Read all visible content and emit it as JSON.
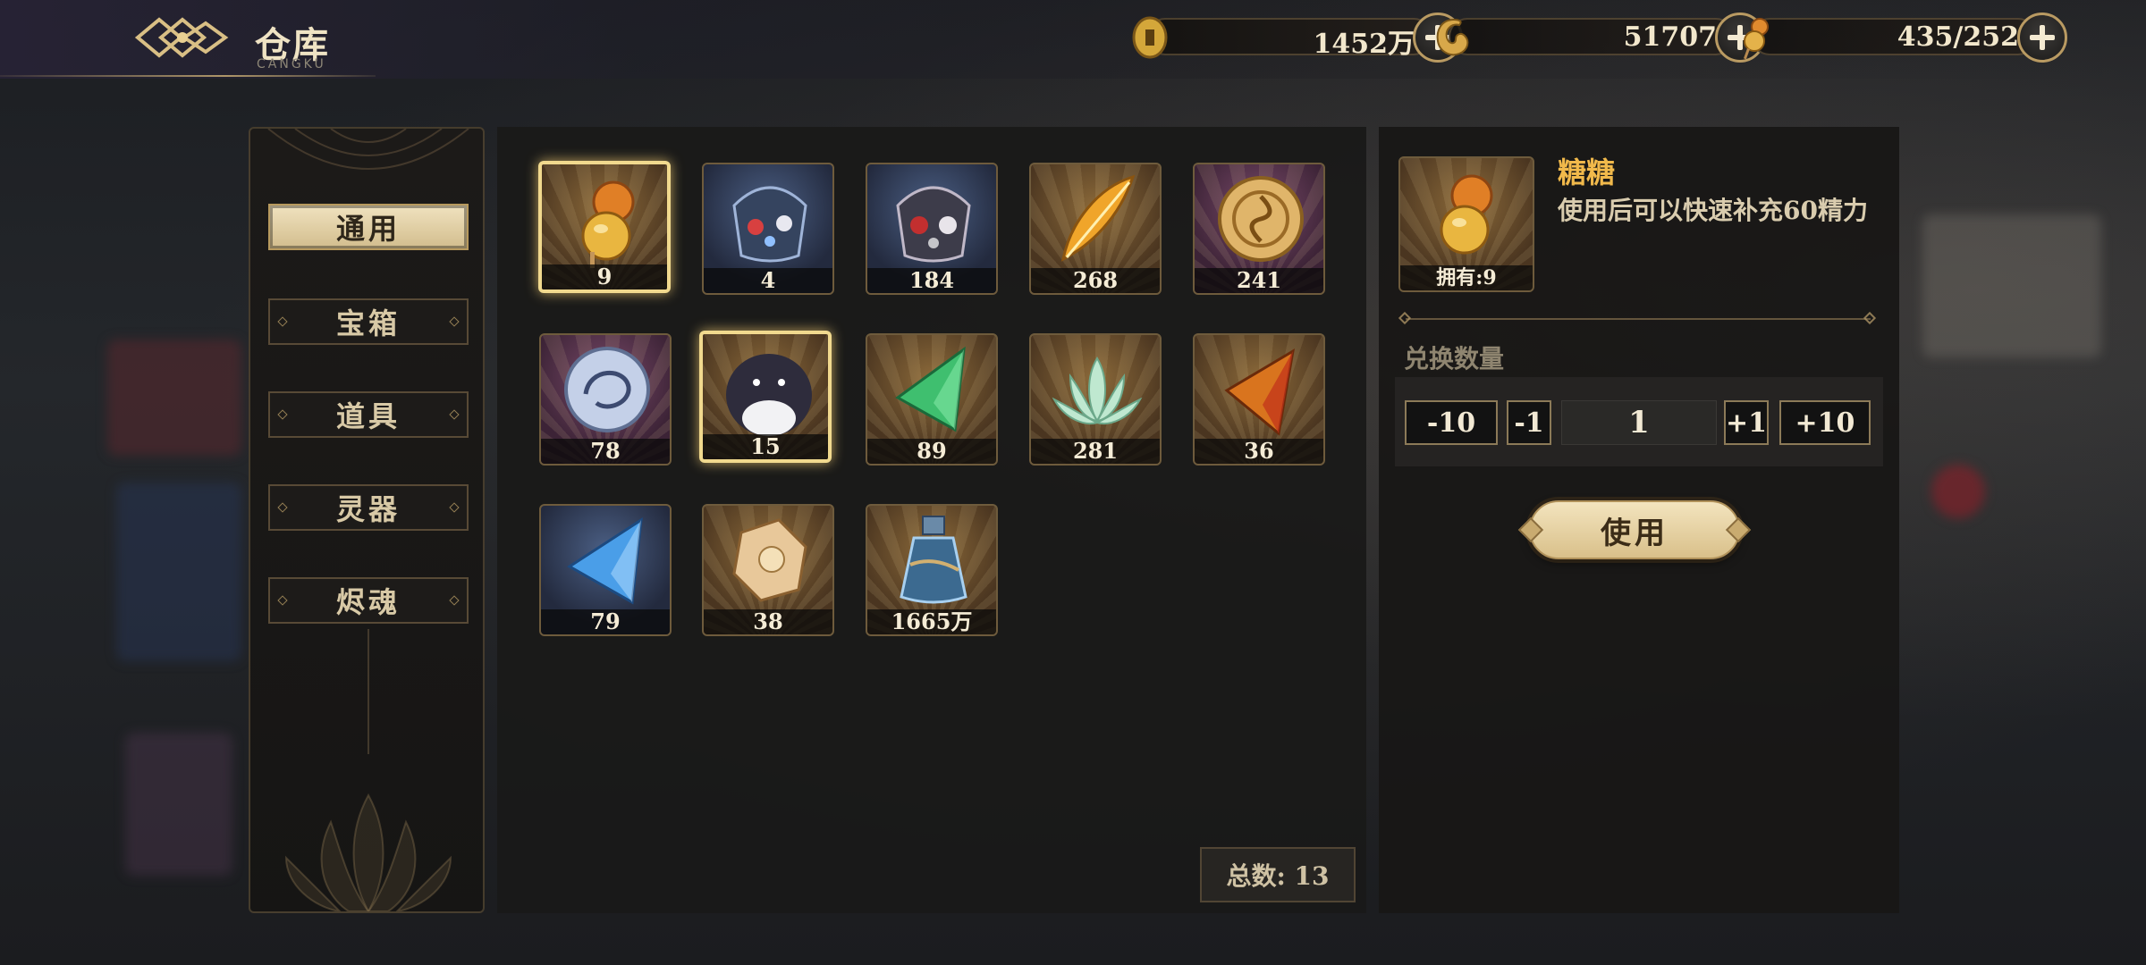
{
  "header": {
    "title": "仓库",
    "subtitle": "CANGKU",
    "currencies": [
      {
        "icon": "copper-coin-icon",
        "value": "1452万"
      },
      {
        "icon": "golden-dragon-icon",
        "value": "51707"
      },
      {
        "icon": "candied-gourd-icon",
        "value": "435/252"
      }
    ]
  },
  "sidebar": {
    "tabs": [
      {
        "label": "通用",
        "active": true
      },
      {
        "label": "宝箱",
        "active": false
      },
      {
        "label": "道具",
        "active": false
      },
      {
        "label": "灵器",
        "active": false
      },
      {
        "label": "烬魂",
        "active": false
      }
    ]
  },
  "inventory": {
    "items": [
      {
        "icon": "candied-gourd-icon",
        "count": "9",
        "bg": "gold",
        "selected": true
      },
      {
        "icon": "blue-dice-pouch-icon",
        "count": "4",
        "bg": "blue"
      },
      {
        "icon": "red-dice-pouch-icon",
        "count": "184",
        "bg": "blue"
      },
      {
        "icon": "golden-feather-icon",
        "count": "268",
        "bg": "gold"
      },
      {
        "icon": "gold-triskelion-disc-icon",
        "count": "241",
        "bg": "purple"
      },
      {
        "icon": "silver-dragon-disc-icon",
        "count": "78",
        "bg": "purple"
      },
      {
        "icon": "penguin-doll-icon",
        "count": "15",
        "bg": "gold",
        "selected": true
      },
      {
        "icon": "green-crystal-icon",
        "count": "89",
        "bg": "gold"
      },
      {
        "icon": "jade-lotus-icon",
        "count": "281",
        "bg": "gold"
      },
      {
        "icon": "fire-crystal-icon",
        "count": "36",
        "bg": "gold"
      },
      {
        "icon": "blue-crystal-icon",
        "count": "79",
        "bg": "blue"
      },
      {
        "icon": "amber-ore-icon",
        "count": "38",
        "bg": "gold"
      },
      {
        "icon": "blue-potion-bottle-icon",
        "count": "1665万",
        "bg": "gold"
      }
    ],
    "total_label": "总数: 13"
  },
  "detail": {
    "icon": "candied-gourd-icon",
    "owned_label": "拥有:9",
    "name": "糖糖",
    "description": "使用后可以快速补充60精力",
    "quantity_label": "兑换数量",
    "buttons": {
      "minus10": "-10",
      "minus1": "-1",
      "plus1": "+1",
      "plus10": "+10"
    },
    "quantity": "1",
    "use_label": "使用"
  },
  "colors": {
    "accent_gold": "#f1b94b",
    "tab_active_bg": "#e6d4a6",
    "selected_border": "#f1d98e"
  }
}
